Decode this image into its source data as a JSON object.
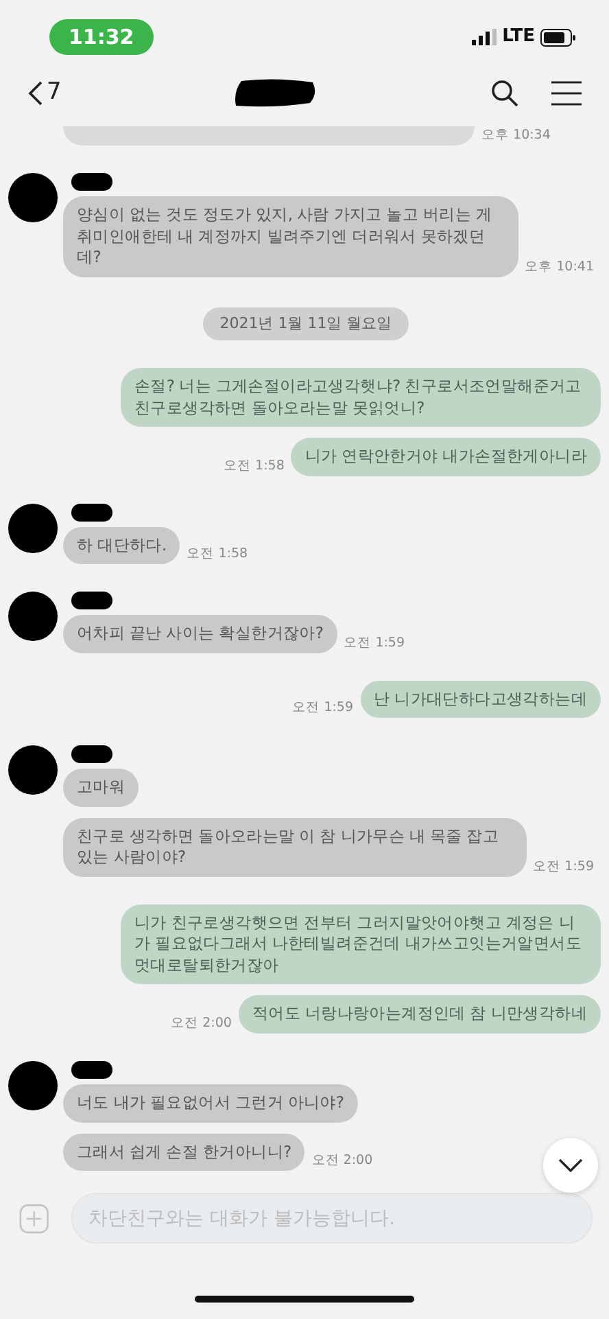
{
  "status_bar": {
    "time": "11:32",
    "network": "LTE"
  },
  "header": {
    "back_count": "7"
  },
  "messages": [
    {
      "kind": "obscured",
      "time": "오후 10:34"
    },
    {
      "kind": "in",
      "profile": true,
      "text": "양심이 없는 것도 정도가 있지, 사람 가지고 놀고 버리는 게 취미인애한테 내 계정까지 빌려주기엔 더러워서 못하겠던데?",
      "time": "오후 10:41"
    },
    {
      "kind": "date",
      "text": "2021년 1월 11일 월요일"
    },
    {
      "kind": "out",
      "text": "손절? 너는 그게손절이라고생각햇냐? 친구로서조언말해준거고 친구로생각하면 돌아오라는말 못읽엇니?"
    },
    {
      "kind": "out",
      "text": "니가 연락안한거야 내가손절한게아니라",
      "time": "오전 1:58"
    },
    {
      "kind": "in",
      "profile": true,
      "text": "하 대단하다.",
      "time": "오전 1:58"
    },
    {
      "kind": "in",
      "profile": true,
      "text": "어차피 끝난 사이는 확실한거잖아?",
      "time": "오전 1:59"
    },
    {
      "kind": "out",
      "text": "난 니가대단하다고생각하는데",
      "time": "오전 1:59"
    },
    {
      "kind": "in",
      "profile": true,
      "text": "고마워"
    },
    {
      "kind": "in",
      "profile": false,
      "text": "친구로 생각하면 돌아오라는말 이 참 니가무슨 내 목줄 잡고있는 사람이야?",
      "time": "오전 1:59"
    },
    {
      "kind": "out",
      "text": "니가 친구로생각햇으면 전부터 그러지말앗어야햇고 계정은 니가 필요없다그래서 나한테빌려준건데 내가쓰고잇는거알면서도 멋대로탈퇴한거잖아"
    },
    {
      "kind": "out",
      "text": "적어도 너랑나랑아는계정인데 참 니만생각하네",
      "time": "오전 2:00"
    },
    {
      "kind": "in",
      "profile": true,
      "text": "너도 내가 필요없어서 그런거 아니야?"
    },
    {
      "kind": "in",
      "profile": false,
      "text": "그래서 쉽게 손절 한거아니니?",
      "time": "오전 2:00"
    }
  ],
  "input": {
    "placeholder": "차단친구와는 대화가 불가능합니다."
  }
}
